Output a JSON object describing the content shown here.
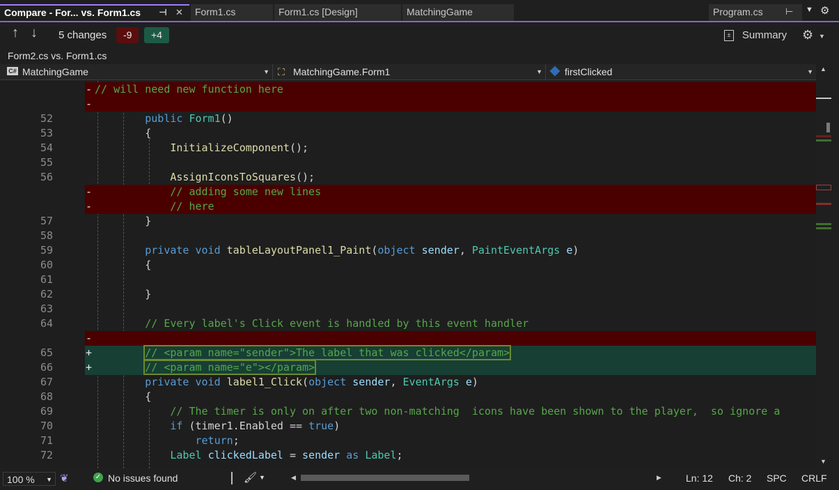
{
  "tabs": [
    {
      "label": "Compare - For... vs. Form1.cs",
      "active": true
    },
    {
      "label": "Form1.cs",
      "active": false
    },
    {
      "label": "Form1.cs [Design]",
      "active": false
    },
    {
      "label": "MatchingGame",
      "active": false
    }
  ],
  "right_tab": {
    "label": "Program.cs"
  },
  "compare_toolbar": {
    "changes_label": "5 changes",
    "removed_count": "-9",
    "added_count": "+4",
    "summary_label": "Summary"
  },
  "compare_title": "Form2.cs vs. Form1.cs",
  "navigation": {
    "project": "MatchingGame",
    "type": "MatchingGame.Form1",
    "member": "firstClicked"
  },
  "code_lines": [
    {
      "num": "",
      "mark": "-",
      "kind": "del",
      "text": "// will need new function here"
    },
    {
      "num": "",
      "mark": "-",
      "kind": "del",
      "text": ""
    },
    {
      "num": "52",
      "mark": "",
      "kind": "",
      "text": "        public Form1()"
    },
    {
      "num": "53",
      "mark": "",
      "kind": "",
      "text": "        {"
    },
    {
      "num": "54",
      "mark": "",
      "kind": "",
      "text": "            InitializeComponent();"
    },
    {
      "num": "55",
      "mark": "",
      "kind": "",
      "text": ""
    },
    {
      "num": "56",
      "mark": "",
      "kind": "",
      "text": "            AssignIconsToSquares();"
    },
    {
      "num": "",
      "mark": "-",
      "kind": "del",
      "text": "            // adding some new lines"
    },
    {
      "num": "",
      "mark": "-",
      "kind": "del",
      "text": "            // here"
    },
    {
      "num": "57",
      "mark": "",
      "kind": "",
      "text": "        }"
    },
    {
      "num": "58",
      "mark": "",
      "kind": "",
      "text": ""
    },
    {
      "num": "59",
      "mark": "",
      "kind": "",
      "text": "        private void tableLayoutPanel1_Paint(object sender, PaintEventArgs e)"
    },
    {
      "num": "60",
      "mark": "",
      "kind": "",
      "text": "        {"
    },
    {
      "num": "61",
      "mark": "",
      "kind": "",
      "text": ""
    },
    {
      "num": "62",
      "mark": "",
      "kind": "",
      "text": "        }"
    },
    {
      "num": "63",
      "mark": "",
      "kind": "",
      "text": ""
    },
    {
      "num": "64",
      "mark": "",
      "kind": "",
      "text": "        // Every label's Click event is handled by this event handler"
    },
    {
      "num": "",
      "mark": "-",
      "kind": "del",
      "text": ""
    },
    {
      "num": "65",
      "mark": "+",
      "kind": "add",
      "text": "        // <param name=\"sender\">The label that was clicked</param>"
    },
    {
      "num": "66",
      "mark": "+",
      "kind": "add",
      "text": "        // <param name=\"e\"></param>"
    },
    {
      "num": "67",
      "mark": "",
      "kind": "",
      "text": "        private void label1_Click(object sender, EventArgs e)"
    },
    {
      "num": "68",
      "mark": "",
      "kind": "",
      "text": "        {"
    },
    {
      "num": "69",
      "mark": "",
      "kind": "",
      "text": "            // The timer is only on after two non-matching  icons have been shown to the player,  so ignore a"
    },
    {
      "num": "70",
      "mark": "",
      "kind": "",
      "text": "            if (timer1.Enabled == true)"
    },
    {
      "num": "71",
      "mark": "",
      "kind": "",
      "text": "                return;"
    },
    {
      "num": "72",
      "mark": "",
      "kind": "",
      "text": "            Label clickedLabel = sender as Label;"
    }
  ],
  "status": {
    "zoom": "100 %",
    "issues": "No issues found",
    "line": "Ln: 12",
    "col": "Ch: 2",
    "spc": "SPC",
    "crlf": "CRLF"
  },
  "colors": {
    "accent": "#8a63d2",
    "deleted": "#4b0000",
    "added": "#173f34"
  }
}
